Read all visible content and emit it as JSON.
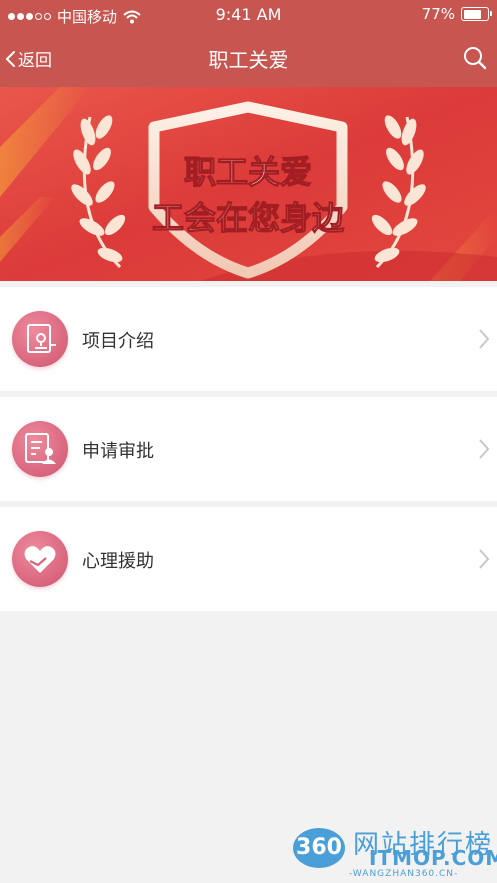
{
  "status_bar": {
    "carrier": "中国移动",
    "time": "9:41 AM",
    "battery": "77%",
    "battery_level": 0.77,
    "signal_bars_filled": 3
  },
  "nav": {
    "back_label": "返回",
    "title": "职工关爱"
  },
  "banner": {
    "line1": "职工关爱",
    "line2": "工会在您身边"
  },
  "menu": [
    {
      "label": "项目介绍",
      "icon": "stamp-document-icon"
    },
    {
      "label": "申请审批",
      "icon": "approval-form-icon"
    },
    {
      "label": "心理援助",
      "icon": "heart-handshake-icon"
    }
  ],
  "watermark": {
    "logo": "360",
    "name": "网站排行榜",
    "domain": "ITMOP.COM",
    "sub": "-WANGZHAN360.CN-"
  },
  "colors": {
    "header": "#c85650",
    "banner_red": "#e0463f",
    "icon_pink": "#d8657c",
    "watermark_blue": "#4a9fd8"
  }
}
